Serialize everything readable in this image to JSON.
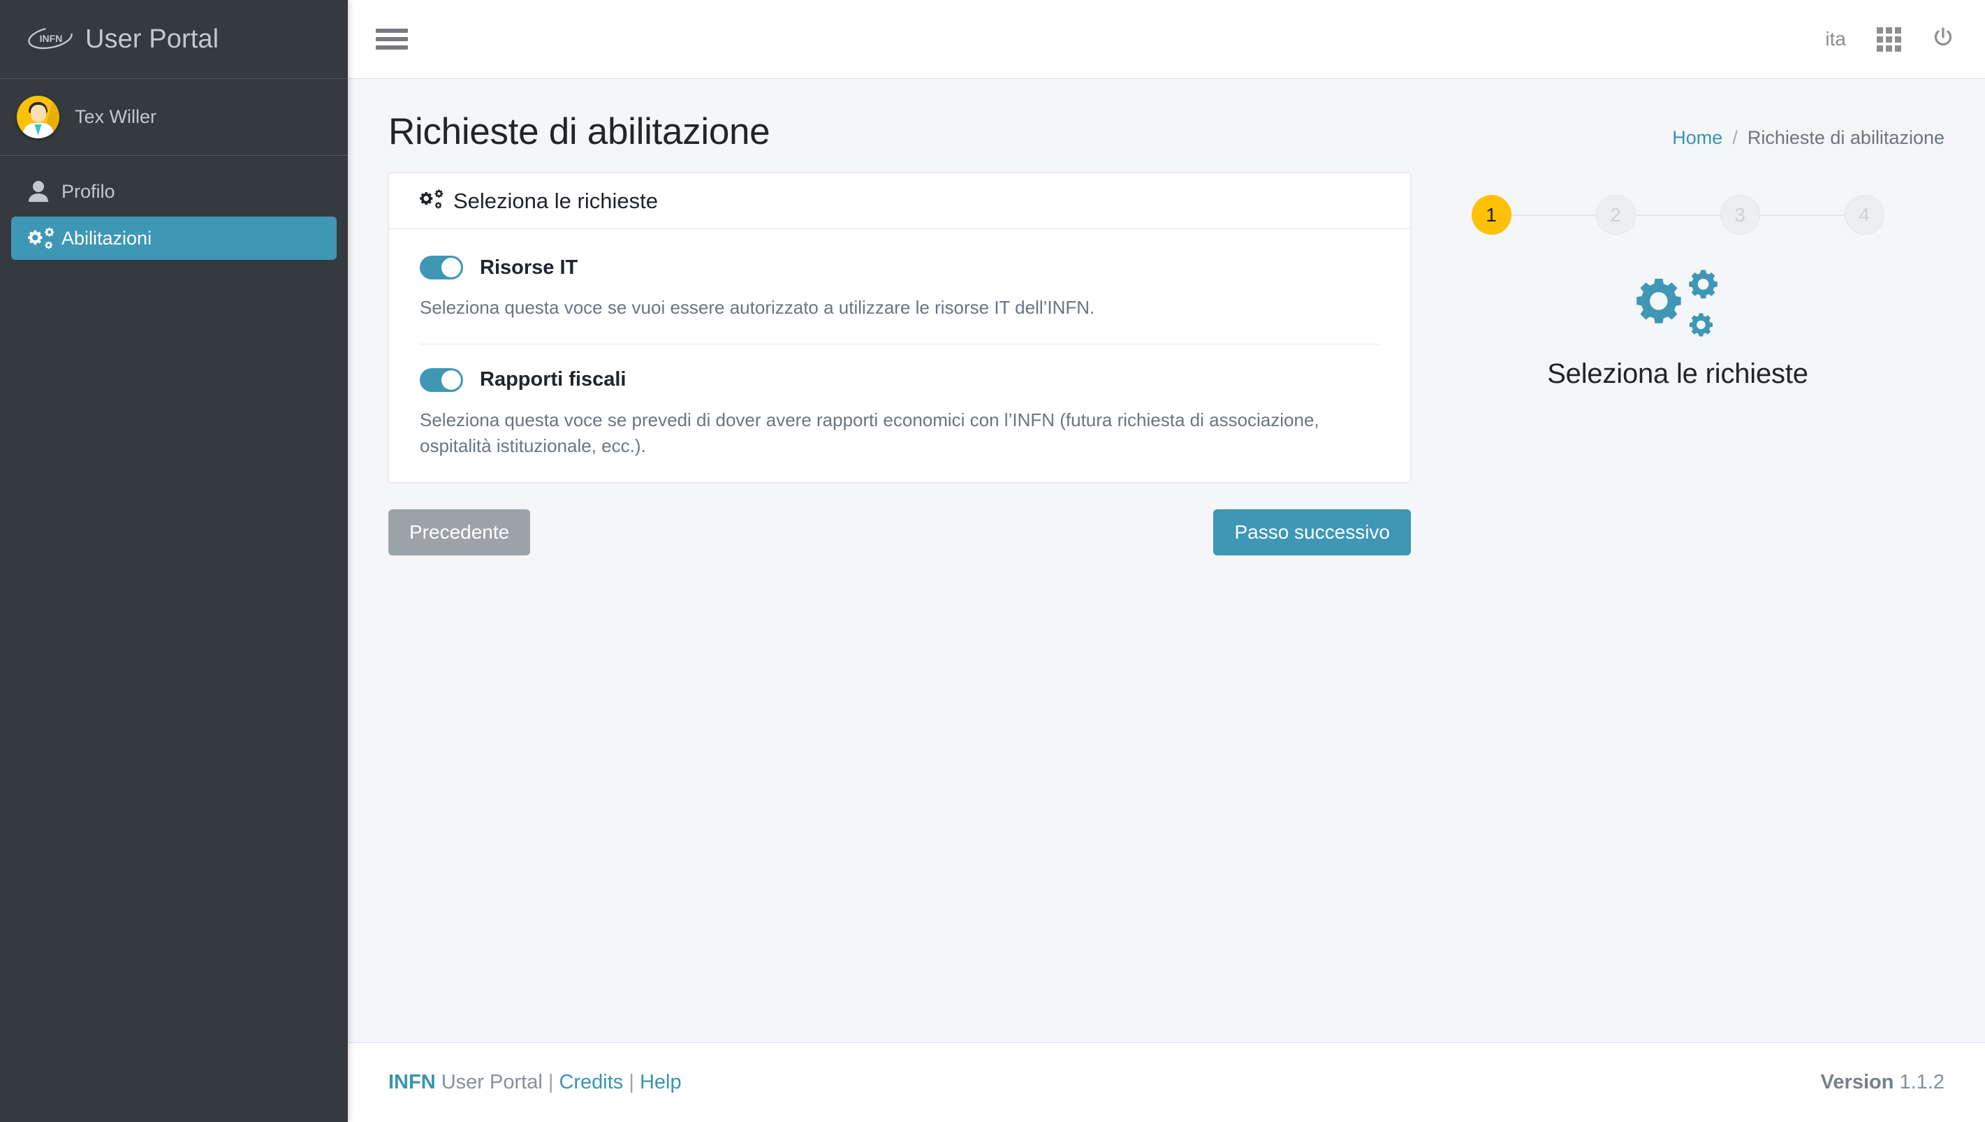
{
  "brand": {
    "logo_icon": "infn-ellipse-logo",
    "logo_text": "INFN",
    "title": "User Portal"
  },
  "sidebar": {
    "user": {
      "avatar_icon": "user-avatar-scientist",
      "name": "Tex Willer"
    },
    "items": [
      {
        "label": "Profilo",
        "icon": "user-icon",
        "active": false
      },
      {
        "label": "Abilitazioni",
        "icon": "cogs-icon",
        "active": true
      }
    ]
  },
  "topbar": {
    "menu_icon": "hamburger-icon",
    "language": "ita",
    "apps_icon": "grid-apps-icon",
    "power_icon": "power-icon"
  },
  "page": {
    "title": "Richieste di abilitazione",
    "breadcrumb": {
      "home": "Home",
      "separator": "/",
      "current": "Richieste di abilitazione"
    }
  },
  "card": {
    "header_icon": "cogs-icon",
    "header_title": "Seleziona le richieste",
    "options": [
      {
        "label": "Risorse IT",
        "enabled": true,
        "description": "Seleziona questa voce se vuoi essere autorizzato a utilizzare le risorse IT dell’INFN."
      },
      {
        "label": "Rapporti fiscali",
        "enabled": true,
        "description": "Seleziona questa voce se prevedi di dover avere rapporti economici con l’INFN (futura richiesta di associazione, ospitalità istituzionale, ecc.)."
      }
    ]
  },
  "buttons": {
    "previous": "Precedente",
    "next": "Passo successivo"
  },
  "stepper": {
    "steps": [
      {
        "number": "1",
        "state": "active"
      },
      {
        "number": "2",
        "state": "idle"
      },
      {
        "number": "3",
        "state": "idle"
      },
      {
        "number": "4",
        "state": "idle"
      }
    ],
    "illustration_icon": "cogs-icon",
    "caption": "Seleziona le richieste"
  },
  "footer": {
    "brand_bold": "INFN",
    "brand_rest": " User Portal ",
    "sep1": "|",
    "credits": "Credits",
    "sep2": "|",
    "help": "Help",
    "version_label": "Version",
    "version_value": "1.1.2"
  },
  "colors": {
    "accent_teal": "#3d97b5",
    "sidebar_dark": "#343a40",
    "active_step_yellow": "#ffc107",
    "link_teal": "#3a93b2",
    "muted_gray": "#6c757d"
  }
}
